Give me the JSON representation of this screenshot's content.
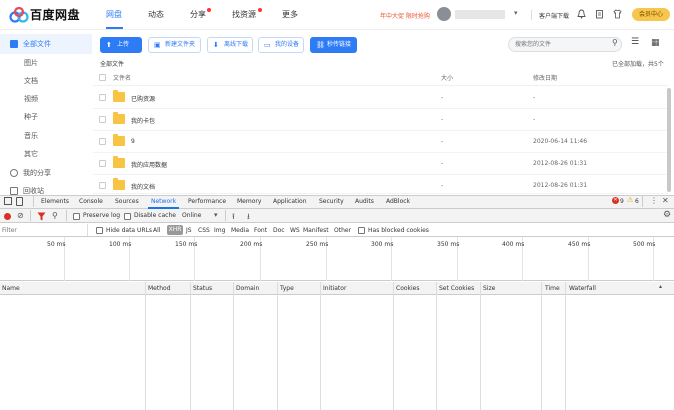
{
  "topnav": {
    "brand": "百度网盘",
    "items": [
      {
        "label": "网盘",
        "active": true,
        "dot": false
      },
      {
        "label": "动态",
        "active": false,
        "dot": false
      },
      {
        "label": "分享",
        "active": false,
        "dot": true
      },
      {
        "label": "找资源",
        "active": false,
        "dot": true
      },
      {
        "label": "更多",
        "active": false,
        "dot": false
      }
    ],
    "promo": "年中大促 限时抢购",
    "client_download": "客户端下载",
    "vip": "会员中心"
  },
  "sidebar": {
    "items": [
      {
        "label": "全部文件",
        "active": true
      },
      {
        "label": "图片"
      },
      {
        "label": "文档"
      },
      {
        "label": "视频"
      },
      {
        "label": "种子"
      },
      {
        "label": "音乐"
      },
      {
        "label": "其它"
      },
      {
        "label": "我的分享"
      },
      {
        "label": "回收站"
      }
    ]
  },
  "toolbar": {
    "upload": "上传",
    "new_folder": "新建文件夹",
    "offline_download": "离线下载",
    "my_devices": "我的设备",
    "transfer_link": "秒传链接",
    "search_placeholder": "搜索您的文件"
  },
  "breadcrumb": "全部文件",
  "loaded_status": "已全部加载，共5个",
  "file_table": {
    "headers": {
      "name": "文件名",
      "size": "大小",
      "date": "修改日期"
    },
    "rows": [
      {
        "name": "已购资源",
        "size": "-",
        "date": "-"
      },
      {
        "name": "我的卡包",
        "size": "-",
        "date": "-"
      },
      {
        "name": "9",
        "size": "-",
        "date": "2020-06-14 11:46"
      },
      {
        "name": "我的应用数据",
        "size": "-",
        "date": "2012-08-26 01:31"
      },
      {
        "name": "我的文档",
        "size": "-",
        "date": "2012-08-26 01:31"
      }
    ]
  },
  "devtools": {
    "tabs": [
      "Elements",
      "Console",
      "Sources",
      "Network",
      "Performance",
      "Memory",
      "Application",
      "Security",
      "Audits",
      "AdBlock"
    ],
    "active_tab": "Network",
    "error_count": "9",
    "warning_count": "6",
    "toolbar": {
      "preserve_log": "Preserve log",
      "disable_cache": "Disable cache",
      "throttle": "Online"
    },
    "filter_placeholder": "Filter",
    "hide_data_urls": "Hide data URLs",
    "types": [
      "All",
      "XHR",
      "JS",
      "CSS",
      "Img",
      "Media",
      "Font",
      "Doc",
      "WS",
      "Manifest",
      "Other"
    ],
    "has_blocked_cookies": "Has blocked cookies",
    "timeline_ticks": [
      "50 ms",
      "100 ms",
      "150 ms",
      "200 ms",
      "250 ms",
      "300 ms",
      "350 ms",
      "400 ms",
      "450 ms",
      "500 ms"
    ],
    "columns": [
      "Name",
      "Method",
      "Status",
      "Domain",
      "Type",
      "Initiator",
      "Cookies",
      "Set Cookies",
      "Size",
      "Time",
      "Waterfall"
    ]
  }
}
